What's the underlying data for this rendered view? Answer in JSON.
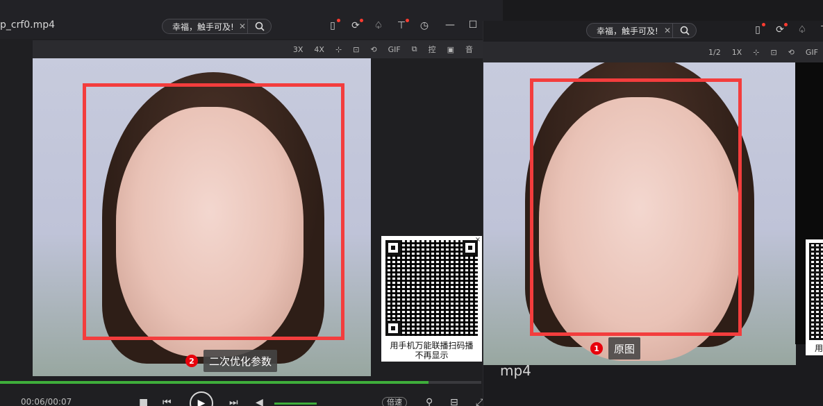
{
  "left_window": {
    "title": "p_crf0.mp4",
    "search": {
      "query": "幸福，触手可及!",
      "clear_icon": "close-icon",
      "button_icon": "search-icon"
    },
    "top_icons": [
      "phone-notify-icon",
      "cloud-sync-icon",
      "skin-icon",
      "tshirt-icon",
      "history-icon"
    ],
    "window_controls": {
      "minimize": "—",
      "maximize": "☐",
      "more": "﹀"
    },
    "toolstrip": [
      "3X",
      "4X",
      "crop-icon",
      "aspect-icon",
      "rotate-icon",
      "GIF",
      "multi-window-icon",
      "控",
      "screenshot-icon",
      "音"
    ],
    "annotation": {
      "number": "2",
      "text": "二次优化参数"
    },
    "qr_caption_line1": "用手机万能联播扫码播",
    "qr_caption_line2": "不再显示",
    "qr_close": "×",
    "progress": 0.89,
    "controls": {
      "time": "00:06/00:07",
      "speed": "倍速"
    }
  },
  "right_window": {
    "search": {
      "query": "幸福，触手可及!",
      "clear_icon": "close-icon",
      "button_icon": "search-icon"
    },
    "top_icons": [
      "phone-notify-icon",
      "cloud-sync-icon",
      "skin-icon",
      "tshirt-icon"
    ],
    "toolstrip": [
      "1/2",
      "1X",
      "crop-icon",
      "aspect-icon",
      "rotate-icon",
      "GIF"
    ],
    "annotation": {
      "number": "1",
      "text": "原图"
    },
    "title_fragment": "mp4",
    "qr_caption_fragment": "用"
  },
  "colors": {
    "roi_box": "#f33d3d",
    "progress": "#3fae3b",
    "badge": "#e8000b"
  }
}
